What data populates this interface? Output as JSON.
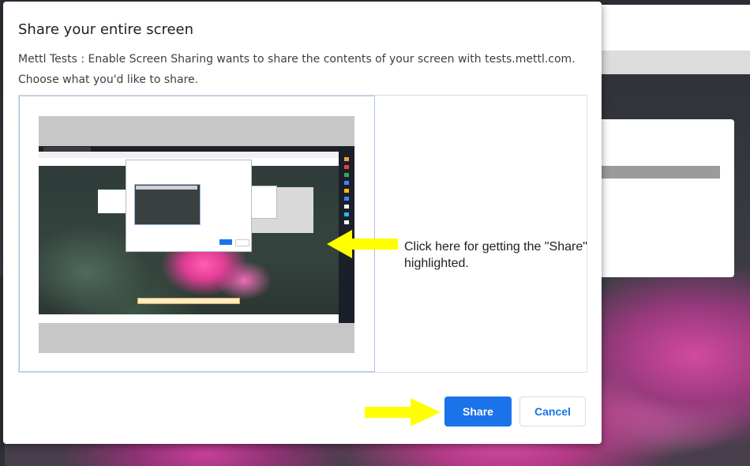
{
  "dialog": {
    "title": "Share your entire screen",
    "description": "Mettl Tests : Enable Screen Sharing wants to share the contents of your screen with tests.mettl.com. Choose what you'd like to share."
  },
  "source": {
    "screen_thumbnail": "screen-thumbnail",
    "hint_text": "Click here for getting the \"Share\" highlighted."
  },
  "buttons": {
    "share_label": "Share",
    "cancel_label": "Cancel"
  },
  "icons": {
    "hint_arrow": "yellow-arrow-left-icon",
    "share_arrow": "yellow-arrow-right-icon"
  },
  "colors": {
    "accent": "#1a73e8",
    "highlight_arrow": "#ffff00",
    "selected_border": "#a7c4ee"
  }
}
